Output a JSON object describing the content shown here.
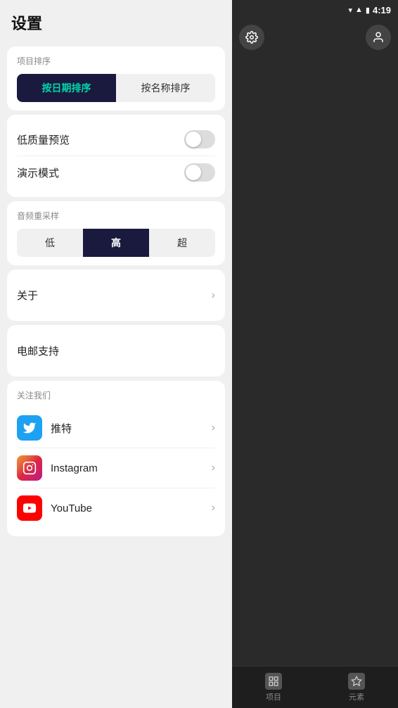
{
  "status_bar": {
    "time": "4:19",
    "wifi_icon": "▾",
    "signal_icon": "▲",
    "battery_icon": "🔋"
  },
  "page": {
    "title": "设置"
  },
  "sort_section": {
    "label": "项目排序",
    "btn_date": "按日期排序",
    "btn_name": "按名称排序"
  },
  "toggles": {
    "low_quality_label": "低质量预览",
    "demo_mode_label": "演示模式"
  },
  "audio_resample": {
    "label": "音频重采样",
    "btn_low": "低",
    "btn_high": "高",
    "btn_ultra": "超"
  },
  "about": {
    "label": "关于"
  },
  "email": {
    "label": "电邮支持"
  },
  "follow": {
    "section_label": "关注我们",
    "twitter_label": "推特",
    "instagram_label": "Instagram",
    "youtube_label": "YouTube"
  },
  "bottom_tabs": {
    "tab1_label": "项目",
    "tab2_label": "元素"
  }
}
